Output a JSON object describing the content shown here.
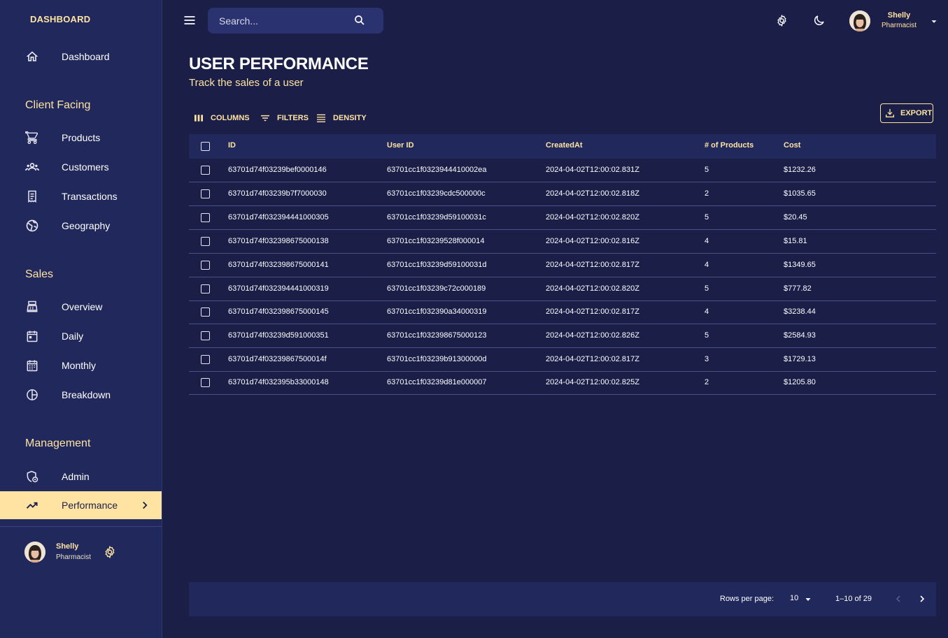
{
  "brand": "DASHBOARD",
  "search": {
    "placeholder": "Search..."
  },
  "user": {
    "name": "Shelly",
    "role": "Pharmacist"
  },
  "sidebar": {
    "top": {
      "label": "Dashboard",
      "icon": "home-icon"
    },
    "sections": [
      {
        "title": "Client Facing",
        "items": [
          {
            "label": "Products",
            "icon": "cart-icon"
          },
          {
            "label": "Customers",
            "icon": "groups-icon"
          },
          {
            "label": "Transactions",
            "icon": "receipt-icon"
          },
          {
            "label": "Geography",
            "icon": "globe-icon"
          }
        ]
      },
      {
        "title": "Sales",
        "items": [
          {
            "label": "Overview",
            "icon": "point-of-sale-icon"
          },
          {
            "label": "Daily",
            "icon": "calendar-today-icon"
          },
          {
            "label": "Monthly",
            "icon": "calendar-month-icon"
          },
          {
            "label": "Breakdown",
            "icon": "pie-chart-icon"
          }
        ]
      },
      {
        "title": "Management",
        "items": [
          {
            "label": "Admin",
            "icon": "admin-icon"
          },
          {
            "label": "Performance",
            "icon": "trending-up-icon",
            "active": true
          }
        ]
      }
    ]
  },
  "header": {
    "title": "USER PERFORMANCE",
    "subtitle": "Track the sales of a user"
  },
  "toolbar": {
    "columns": "COLUMNS",
    "filters": "FILTERS",
    "density": "DENSITY",
    "export": "EXPORT"
  },
  "table": {
    "columns": [
      "ID",
      "User ID",
      "CreatedAt",
      "# of Products",
      "Cost"
    ],
    "rows": [
      [
        "63701d74f03239bef0000146",
        "63701cc1f0323944410002ea",
        "2024-04-02T12:00:02.831Z",
        "5",
        "$1232.26"
      ],
      [
        "63701d74f03239b7f7000030",
        "63701cc1f03239cdc500000c",
        "2024-04-02T12:00:02.818Z",
        "2",
        "$1035.65"
      ],
      [
        "63701d74f032394441000305",
        "63701cc1f03239d59100031c",
        "2024-04-02T12:00:02.820Z",
        "5",
        "$20.45"
      ],
      [
        "63701d74f032398675000138",
        "63701cc1f03239528f000014",
        "2024-04-02T12:00:02.816Z",
        "4",
        "$15.81"
      ],
      [
        "63701d74f032398675000141",
        "63701cc1f03239d59100031d",
        "2024-04-02T12:00:02.817Z",
        "4",
        "$1349.65"
      ],
      [
        "63701d74f032394441000319",
        "63701cc1f03239c72c000189",
        "2024-04-02T12:00:02.820Z",
        "5",
        "$777.82"
      ],
      [
        "63701d74f032398675000145",
        "63701cc1f032390a34000319",
        "2024-04-02T12:00:02.817Z",
        "4",
        "$3238.44"
      ],
      [
        "63701d74f03239d591000351",
        "63701cc1f032398675000123",
        "2024-04-02T12:00:02.826Z",
        "5",
        "$2584.93"
      ],
      [
        "63701d74f03239867500014f",
        "63701cc1f03239b91300000d",
        "2024-04-02T12:00:02.817Z",
        "3",
        "$1729.13"
      ],
      [
        "63701d74f032395b33000148",
        "63701cc1f03239d81e000007",
        "2024-04-02T12:00:02.825Z",
        "2",
        "$1205.80"
      ]
    ]
  },
  "pagination": {
    "rows_label": "Rows per page:",
    "rows_value": "10",
    "range": "1–10 of 29"
  },
  "colors": {
    "background": "#1b1f48",
    "panel": "#21295c",
    "accent": "#ffe3a3"
  }
}
